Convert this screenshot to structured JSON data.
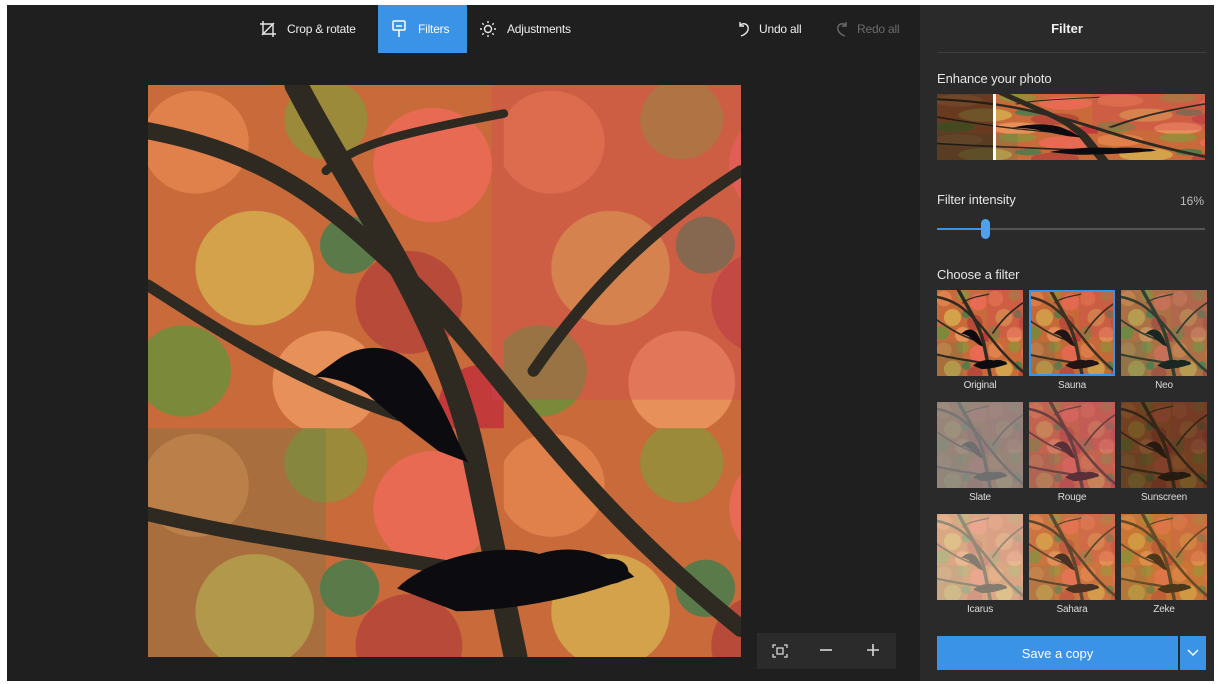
{
  "toolbar": {
    "crop_label": "Crop & rotate",
    "filters_label": "Filters",
    "adjustments_label": "Adjustments",
    "undo_label": "Undo all",
    "redo_label": "Redo all"
  },
  "panel": {
    "title": "Filter",
    "enhance_label": "Enhance your photo",
    "intensity_label": "Filter intensity",
    "intensity_value": "16%",
    "intensity_fraction": 0.16,
    "choose_label": "Choose a filter",
    "save_label": "Save a copy"
  },
  "filters": [
    {
      "name": "Original",
      "tint": "#000000",
      "tint_opacity": 0.0,
      "selected": false
    },
    {
      "name": "Sauna",
      "tint": "#c0603a",
      "tint_opacity": 0.12,
      "selected": true
    },
    {
      "name": "Neo",
      "tint": "#4a8a6a",
      "tint_opacity": 0.22,
      "selected": false
    },
    {
      "name": "Slate",
      "tint": "#8c8c8c",
      "tint_opacity": 0.78,
      "selected": false
    },
    {
      "name": "Rouge",
      "tint": "#b85a6a",
      "tint_opacity": 0.45,
      "selected": false
    },
    {
      "name": "Sunscreen",
      "tint": "#3a2410",
      "tint_opacity": 0.6,
      "selected": false
    },
    {
      "name": "Icarus",
      "tint": "#e8d8c0",
      "tint_opacity": 0.55,
      "selected": false
    },
    {
      "name": "Sahara",
      "tint": "#d88a50",
      "tint_opacity": 0.3,
      "selected": false
    },
    {
      "name": "Zeke",
      "tint": "#c88a30",
      "tint_opacity": 0.35,
      "selected": false
    }
  ],
  "icons": {
    "crop": "crop-rotate-icon",
    "filters": "filters-icon",
    "adjustments": "sun-icon",
    "undo": "undo-icon",
    "redo": "redo-icon",
    "fit": "fit-to-window-icon",
    "zoom_out": "minus-icon",
    "zoom_in": "plus-icon",
    "save_more": "chevron-down-icon"
  },
  "colors": {
    "accent": "#3a93e6",
    "background": "#1f1f1f",
    "panel": "#2a2a2a"
  }
}
